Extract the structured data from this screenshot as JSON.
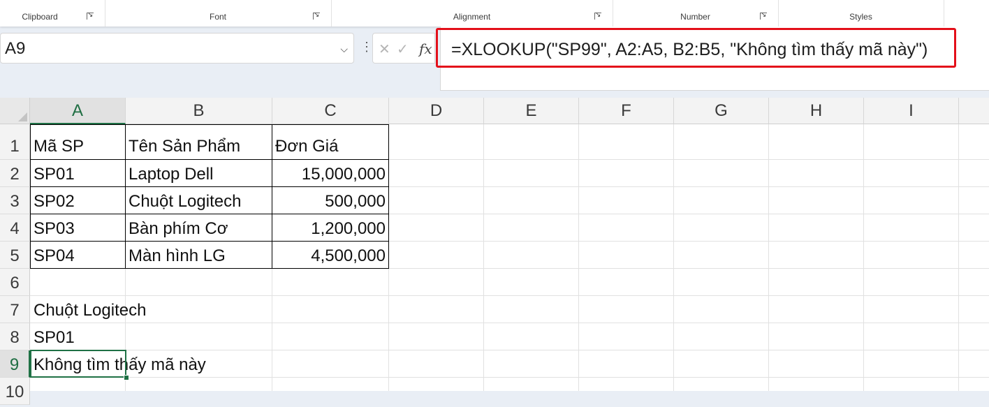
{
  "ribbon": {
    "groups": [
      {
        "label": "Clipboard"
      },
      {
        "label": "Font"
      },
      {
        "label": "Alignment"
      },
      {
        "label": "Number"
      },
      {
        "label": "Styles"
      }
    ]
  },
  "name_box": {
    "value": "A9"
  },
  "formula_bar": {
    "formula": "=XLOOKUP(\"SP99\", A2:A5, B2:B5, \"Không tìm thấy mã này\")",
    "highlight_color": "#e3101a"
  },
  "icons": {
    "cancel": "close-icon",
    "enter": "check-icon",
    "function": "fx-icon",
    "dropdown": "chevron-down-icon",
    "more": "vertical-dots-icon"
  },
  "sheet": {
    "columns": [
      "A",
      "B",
      "C",
      "D",
      "E",
      "F",
      "G",
      "H",
      "I"
    ],
    "rows": [
      "1",
      "2",
      "3",
      "4",
      "5",
      "6",
      "7",
      "8",
      "9",
      "10"
    ],
    "selected_column": "A",
    "selected_row": "9",
    "cells": {
      "A1": "Mã SP",
      "B1": "Tên Sản Phẩm",
      "C1": "Đơn Giá",
      "A2": "SP01",
      "B2": "Laptop Dell",
      "C2": "15,000,000",
      "A3": "SP02",
      "B3": "Chuột Logitech",
      "C3": "500,000",
      "A4": "SP03",
      "B4": "Bàn phím Cơ",
      "C4": "1,200,000",
      "A5": "SP04",
      "B5": "Màn hình LG",
      "C5": "4,500,000",
      "A7": "Chuột Logitech",
      "A8": "SP01",
      "A9": "Không tìm thấy mã này"
    },
    "accent_color": "#1f7145"
  }
}
